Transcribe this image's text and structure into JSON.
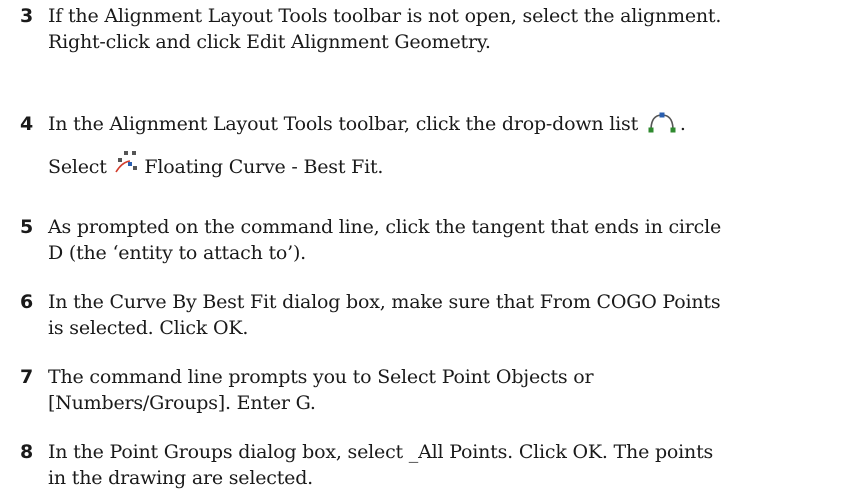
{
  "steps": [
    {
      "number": "3",
      "line1": "If the Alignment Layout Tools toolbar is not open, select the alignment.",
      "line2": "Right-click and click Edit Alignment Geometry."
    },
    {
      "number": "4",
      "line1": "In the Alignment Layout Tools toolbar, click the drop-down list",
      "line1_end": ".",
      "line2_before_icon": "Select",
      "line2_after_icon": "Floating Curve - Best Fit.",
      "dropdown_icon": "curve-dropdown-icon",
      "floating_curve_icon": "floating-curve-best-fit-icon"
    },
    {
      "number": "5",
      "line1": "As prompted on the command line, click the tangent that ends in circle",
      "line2": "D (the ‘entity to attach to’)."
    },
    {
      "number": "6",
      "line1": "In the Curve By Best Fit dialog box, make sure that From COGO Points",
      "line2": "is selected. Click OK."
    },
    {
      "number": "7",
      "line1": "The command line prompts you to Select Point Objects or",
      "line2": "[Numbers/Groups]. Enter G."
    },
    {
      "number": "8",
      "line1": "In the Point Groups dialog box, select _All Points. Click OK. The points",
      "line2": "in the drawing are selected."
    }
  ],
  "colors": {
    "text": "#1a1a1a",
    "icon_green": "#2f8a2f",
    "icon_blue": "#2a5fb0",
    "icon_red": "#d23c2c"
  }
}
